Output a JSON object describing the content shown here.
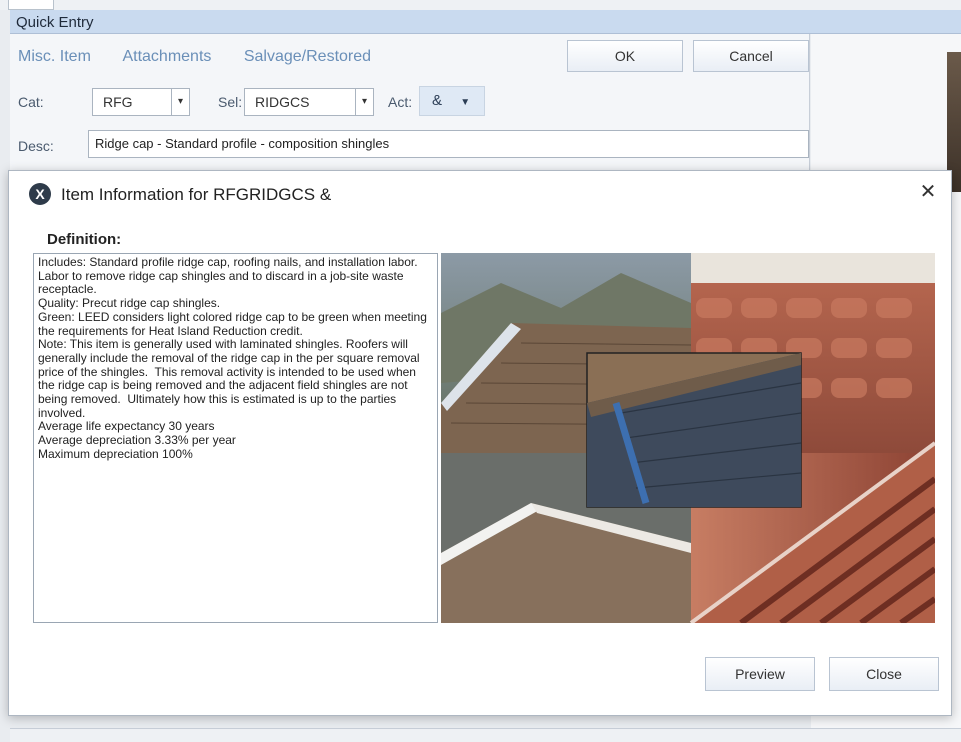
{
  "quick_entry": {
    "title": "Quick Entry",
    "tabs": [
      "Misc. Item",
      "Attachments",
      "Salvage/Restored"
    ],
    "ok_label": "OK",
    "cancel_label": "Cancel",
    "cat_label": "Cat:",
    "cat_value": "RFG",
    "sel_label": "Sel:",
    "sel_value": "RIDGCS",
    "act_label": "Act:",
    "act_value": "&",
    "desc_label": "Desc:",
    "desc_value": "Ridge cap - Standard profile - composition shingles"
  },
  "dialog": {
    "icon": "x-logo-icon",
    "title": "Item Information for RFGRIDGCS &",
    "definition_heading": "Definition:",
    "definition_text": "Includes: Standard profile ridge cap, roofing nails, and installation labor.  Labor to remove ridge cap shingles and to discard in a job-site waste receptacle.\nQuality: Precut ridge cap shingles.\nGreen: LEED considers light colored ridge cap to be green when meeting the requirements for Heat Island Reduction credit.\nNote: This item is generally used with laminated shingles. Roofers will generally include the removal of the ridge cap in the per square removal price of the shingles.  This removal activity is intended to be used when the ridge cap is being removed and the adjacent field shingles are not being removed.  Ultimately how this is estimated is up to the parties involved.\nAverage life expectancy 30 years\nAverage depreciation 3.33% per year\nMaximum depreciation 100%",
    "preview_label": "Preview",
    "close_label": "Close"
  }
}
